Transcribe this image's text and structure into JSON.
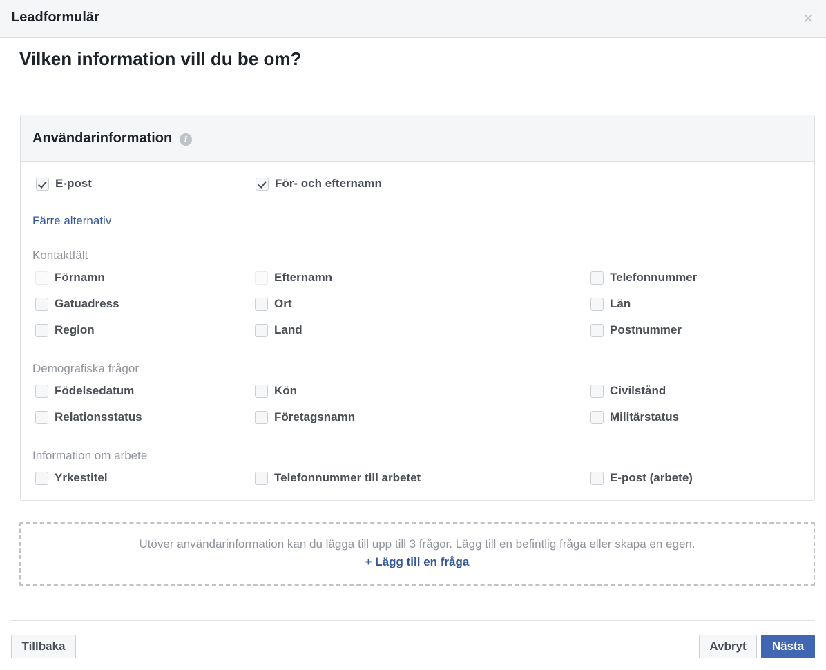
{
  "dialog": {
    "title": "Leadformulär",
    "close_glyph": "×"
  },
  "question_title": "Vilken information vill du be om?",
  "user_info": {
    "title": "Användarinformation",
    "info_glyph": "i",
    "selected": [
      {
        "label": "E-post",
        "checked": true
      },
      {
        "label": "För- och efternamn",
        "checked": true
      }
    ],
    "fewer_options": "Färre alternativ",
    "sections": [
      {
        "label": "Kontaktfält",
        "rows": [
          [
            "Förnamn",
            "Efternamn",
            "Telefonnummer"
          ],
          [
            "Gatuadress",
            "Ort",
            "Län"
          ],
          [
            "Region",
            "Land",
            "Postnummer"
          ]
        ]
      },
      {
        "label": "Demografiska frågor",
        "rows": [
          [
            "Födelsedatum",
            "Kön",
            "Civilstånd"
          ],
          [
            "Relationsstatus",
            "Företagsnamn",
            "Militärstatus"
          ]
        ]
      },
      {
        "label": "Information om arbete",
        "rows": [
          [
            "Yrkestitel",
            "Telefonnummer till arbetet",
            "E-post (arbete)"
          ]
        ]
      }
    ]
  },
  "custom_questions": {
    "hint": "Utöver användarinformation kan du lägga till upp till 3 frågor. Lägg till en befintlig fråga eller skapa en egen.",
    "add_link": "+ Lägg till en fråga"
  },
  "footer": {
    "back": "Tillbaka",
    "cancel": "Avbryt",
    "next": "Nästa"
  },
  "colors": {
    "accent": "#4267b2",
    "link": "#365899",
    "muted_text": "#90949c",
    "label_text": "#4b4f56"
  }
}
